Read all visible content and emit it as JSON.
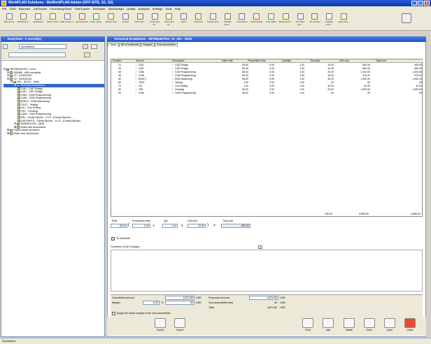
{
  "window": {
    "title": "WorkPLAN Solutions - MyWorkPLAN Admin (OFF-SITE, S1, S2)"
  },
  "menu": [
    "File",
    "CRM",
    "Estimator",
    "JobTracker",
    "Purchasing/Stock",
    "TimeTracker",
    "Scheduler",
    "InfoManager",
    "Quality",
    "Analyses",
    "Settings",
    "Tools",
    "Help"
  ],
  "toolbar": [
    {
      "label": "Resources",
      "icon": "resources-icon"
    },
    {
      "label": "Workshop ti...",
      "icon": "workshop-icon"
    },
    {
      "label": "Quotations",
      "icon": "quotations-icon"
    },
    {
      "label": "Sales orders",
      "icon": "sales-orders-icon"
    },
    {
      "label": "Sales order li...",
      "icon": "sales-order-lines-icon"
    },
    {
      "label": "Invoiced jobs",
      "icon": "invoiced-jobs-icon"
    },
    {
      "label": "Order mode...",
      "icon": "order-mode-icon"
    },
    {
      "label": "Shipper Doc",
      "icon": "shipper-icon"
    },
    {
      "label": "Invoice",
      "icon": "invoice-icon"
    },
    {
      "label": "Gantt sch...",
      "icon": "gantt-icon"
    },
    {
      "label": "Notes and do...",
      "icon": "notes-icon"
    },
    {
      "label": "Document se...",
      "icon": "document-icon"
    },
    {
      "label": "Alarm",
      "icon": "alarm-icon"
    },
    {
      "label": "Indicators",
      "icon": "indicators-icon"
    },
    {
      "label": "Components",
      "icon": "components-icon"
    },
    {
      "label": "Storage locat...",
      "icon": "storage-icon"
    },
    {
      "label": "Inventories",
      "icon": "inventories-icon"
    },
    {
      "label": "Stock details",
      "icon": "stock-icon"
    },
    {
      "label": "User rights",
      "icon": "user-rights-icon"
    },
    {
      "label": "Requests for...",
      "icon": "requests-icon"
    },
    {
      "label": "Purchase ord...",
      "icon": "purchase-icon"
    },
    {
      "label": "PO receipts",
      "icon": "po-receipts-icon"
    },
    {
      "label": "Supplier invoi...",
      "icon": "supplier-invoice-icon"
    },
    {
      "label": "Gantt rela...",
      "icon": "gantt-rel-icon"
    }
  ],
  "left_panel": {
    "title": "EasyView - 1 record(s)",
    "filter_value": "Quotations",
    "tree": [
      {
        "indent": 0,
        "label": "987983487923 - Lemo"
      },
      {
        "indent": 1,
        "label": "035688 - ARK Industrial"
      },
      {
        "indent": 1,
        "label": "V1 - 04/30/2010"
      },
      {
        "indent": 1,
        "label": "V2 - 04/30/2010"
      },
      {
        "indent": 2,
        "label": "001 - MOLD - Mold"
      },
      {
        "indent": 3,
        "label": "Technical breakdown",
        "selected": true
      },
      {
        "indent": 4,
        "label": "CAD - CAD Design"
      },
      {
        "indent": 4,
        "label": "CAD - CAD Design"
      },
      {
        "indent": 4,
        "label": "CAM - CAM Programming"
      },
      {
        "indent": 4,
        "label": "CAM - CAM Programming"
      },
      {
        "indent": 4,
        "label": "EDM II - EDM Machining"
      },
      {
        "indent": 4,
        "label": "TEST - Testing"
      },
      {
        "indent": 4,
        "label": "GD - Gun Drilling"
      },
      {
        "indent": 4,
        "label": "GRI - Grinding"
      },
      {
        "indent": 4,
        "label": "CAM - CAM Programming"
      },
      {
        "indent": 4,
        "label": "RM - Cavity Ejector - H-13 - (Cavity Ejector)"
      },
      {
        "indent": 4,
        "label": "DIE-PARTS - Cavity Ejector - H-13 - (Cavity Ejector)"
      },
      {
        "indent": 3,
        "label": "903905 A 001 - Mold"
      },
      {
        "indent": 3,
        "label": "Notes and documents"
      },
      {
        "indent": 1,
        "label": "Project team members"
      },
      {
        "indent": 1,
        "label": "Notes and documents"
      }
    ]
  },
  "right_panel": {
    "title": "Technical breakdown - 987983487923_02_001 - Mold",
    "tabs": [
      "Tasks",
      "Bill of materials",
      "Margins",
      "Sub-assemblies"
    ]
  },
  "grid": {
    "columns": [
      "Position",
      "Service",
      "Description",
      "Sales rate",
      "Preparation time",
      "Quantity",
      "Time/Qty",
      "Unit cost",
      "Total cost"
    ],
    "rows": [
      [
        "10",
        "CAD",
        "CAD Design",
        "65.00",
        "0.00",
        "1.00",
        "10.00",
        "650.00",
        "650.00"
      ],
      [
        "20",
        "CAD",
        "CAD Design",
        "65.00",
        "0.00",
        "1.00",
        "10.00",
        "650.00",
        "650.00"
      ],
      [
        "30",
        "CAM",
        "CAM Programming",
        "65.00",
        "0.00",
        "1.00",
        "20.00",
        "1,300.00",
        "1,300.00"
      ],
      [
        "40",
        "CAM",
        "CAM Programming",
        "65.00",
        "0.00",
        "1.00",
        "15.00",
        "975.00",
        "975.00"
      ],
      [
        "50",
        "EDM II",
        "EDM Machining",
        "65.00",
        "0.00",
        "1.00",
        "30.00",
        "1,950.00",
        "1,950.00"
      ],
      [
        "60",
        "TEST",
        "Testing",
        "1.00",
        "0.00",
        "1.00",
        ".00",
        ".00",
        ".00"
      ],
      [
        "70",
        "GD",
        "Gun Drilling",
        "1.00",
        "0.00",
        "1.00",
        "40.00",
        "40.00",
        "40.00"
      ],
      [
        "80",
        "GRI",
        "Grinding",
        "65.00",
        "0.00",
        "1.00",
        "20.00",
        "1,300.00",
        "1,300.00"
      ],
      [
        "90",
        "CAM",
        "CAM Programming",
        "65.00",
        "0.00",
        "1.00",
        ".00",
        ".00",
        ".00"
      ]
    ],
    "totals": {
      "time": "105.00",
      "unit_cost": "6,865.00",
      "total_cost": "6,865.00"
    }
  },
  "calc": {
    "rate_label": "Rate",
    "rate": "65.00",
    "prep_label": "Preparation time",
    "prep": "0.00",
    "qty_label": "Qty",
    "qty": "1.00",
    "unit_label": "Unit time",
    "unit": "10.00",
    "total_label": "Total cost",
    "total": "650.00"
  },
  "to_schedule_label": "To schedule",
  "comment_label": "Comment (CAD Design):",
  "summary": {
    "calculated_label": "Calculated amount",
    "calculated": "6,874.80",
    "calc_cur": "USD",
    "margin_label": "Margin",
    "margin_pct": "0.00",
    "pct_sign": "%",
    "margin": ".00",
    "margin_cur": "USD",
    "proposed_label": "Proposed amount",
    "proposed": "6,874.80",
    "prop_cur": "USD",
    "subasm_label": "Sub-assemblies total",
    "subasm": ".00",
    "sub_cur": "USD",
    "total_label": "Total",
    "total": "6,874.80",
    "total_cur": "USD",
    "apply_label": "Apply the same margin to the sub-assemblies"
  },
  "bottom_buttons": [
    {
      "label": "Export",
      "icon": "export-icon"
    },
    {
      "label": "Import",
      "icon": "import-icon"
    },
    {
      "label": "Print",
      "icon": "print-icon"
    },
    {
      "label": "Add",
      "icon": "add-icon"
    },
    {
      "label": "Delete",
      "icon": "delete-icon"
    },
    {
      "label": "Save",
      "icon": "save-icon"
    },
    {
      "label": "Undo",
      "icon": "undo-icon"
    },
    {
      "label": "Close",
      "icon": "close-icon"
    }
  ],
  "status": "Quotations"
}
